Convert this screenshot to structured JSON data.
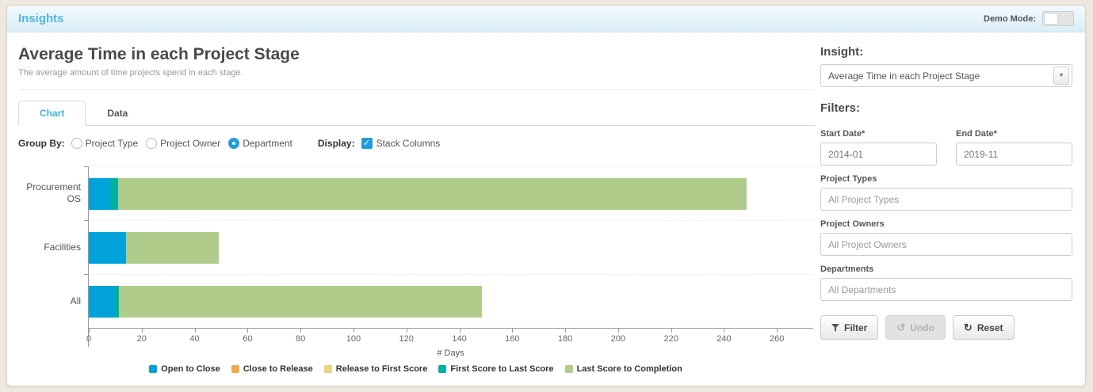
{
  "header": {
    "title": "Insights",
    "demo_mode_label": "Demo Mode:"
  },
  "page": {
    "title": "Average Time in each Project Stage",
    "subtitle": "The average amount of time projects spend in each stage."
  },
  "tabs": [
    {
      "label": "Chart",
      "active": true
    },
    {
      "label": "Data",
      "active": false
    }
  ],
  "controls": {
    "group_by_label": "Group By:",
    "radios": [
      {
        "label": "Project Type",
        "selected": false
      },
      {
        "label": "Project Owner",
        "selected": false
      },
      {
        "label": "Department",
        "selected": true
      }
    ],
    "display_label": "Display:",
    "stack_checkbox_label": "Stack Columns",
    "stack_checked": true
  },
  "chart_data": {
    "type": "bar",
    "orientation": "horizontal",
    "stacked": true,
    "categories": [
      "Procurement OS",
      "Facilities",
      "All"
    ],
    "series": [
      {
        "name": "Open to Close",
        "color": "#00a3d9",
        "values": [
          8,
          14,
          10
        ]
      },
      {
        "name": "Close to Release",
        "color": "#f0a94f",
        "values": [
          0,
          0,
          0
        ]
      },
      {
        "name": "Release to First Score",
        "color": "#e6d77d",
        "values": [
          0,
          0,
          0
        ]
      },
      {
        "name": "First Score to Last Score",
        "color": "#00b1a2",
        "values": [
          3,
          0,
          1.5
        ]
      },
      {
        "name": "Last Score to Completion",
        "color": "#afcc8b",
        "values": [
          237.5,
          35,
          137
        ]
      }
    ],
    "xlabel": "# Days",
    "x_ticks": [
      0,
      20,
      40,
      60,
      80,
      100,
      120,
      140,
      160,
      180,
      200,
      220,
      240,
      260
    ],
    "x_max": 274,
    "legend_position": "bottom",
    "grid": "dashed-row-separators"
  },
  "sidebar": {
    "insight_label": "Insight:",
    "insight_value": "Average Time in each Project Stage",
    "filters_label": "Filters:",
    "fields": {
      "start_date": {
        "label": "Start Date*",
        "value": "2014-01"
      },
      "end_date": {
        "label": "End Date*",
        "value": "2019-11"
      },
      "project_types": {
        "label": "Project Types",
        "placeholder": "All Project Types"
      },
      "project_owners": {
        "label": "Project Owners",
        "placeholder": "All Project Owners"
      },
      "departments": {
        "label": "Departments",
        "placeholder": "All Departments"
      }
    },
    "buttons": {
      "filter": "Filter",
      "undo": "Undo",
      "reset": "Reset"
    }
  }
}
